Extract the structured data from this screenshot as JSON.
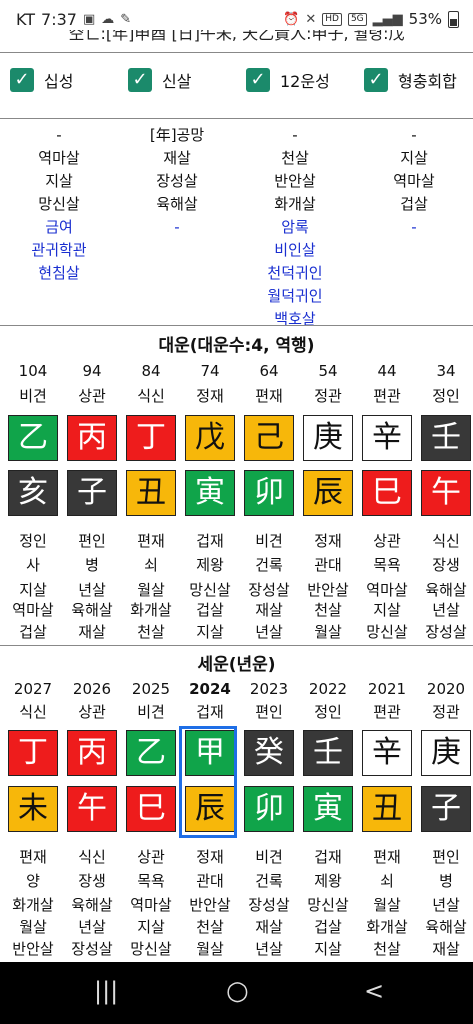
{
  "status": {
    "carrier": "KT",
    "time": "7:37",
    "icons_left": [
      "gallery-icon",
      "cloud-icon",
      "app-icon"
    ],
    "hd_label": "HD",
    "net_label": "5G",
    "battery": "53%"
  },
  "top_partial_text": "空亡:[年]申酉 [日]午未, 天乙貴人:申子, 월령:戊",
  "checkboxes": [
    {
      "label": "십성",
      "checked": true
    },
    {
      "label": "신살",
      "checked": true
    },
    {
      "label": "12운성",
      "checked": true
    },
    {
      "label": "형충회합",
      "checked": true
    }
  ],
  "shinsal": {
    "columns": [
      {
        "head": "-",
        "black": [
          "역마살",
          "지살",
          "망신살"
        ],
        "blue": [
          "금여",
          "관귀학관",
          "현침살"
        ]
      },
      {
        "head": "[年]공망",
        "black": [
          "재살",
          "장성살",
          "육해살"
        ],
        "blue": [
          "-"
        ]
      },
      {
        "head": "-",
        "black": [
          "천살",
          "반안살",
          "화개살"
        ],
        "blue": [
          "암록",
          "비인살",
          "천덕귀인",
          "월덕귀인",
          "백호살"
        ]
      },
      {
        "head": "-",
        "black": [
          "지살",
          "역마살",
          "겁살"
        ],
        "blue": [
          "-"
        ]
      }
    ]
  },
  "daeun": {
    "title": "대운(대운수:4, 역행)",
    "ages": [
      "104",
      "94",
      "84",
      "74",
      "64",
      "54",
      "44",
      "34"
    ],
    "top_ten_gods": [
      "비견",
      "상관",
      "식신",
      "정재",
      "편재",
      "정관",
      "편관",
      "정인"
    ],
    "stems": [
      {
        "char": "乙",
        "color": "green"
      },
      {
        "char": "丙",
        "color": "red"
      },
      {
        "char": "丁",
        "color": "red"
      },
      {
        "char": "戊",
        "color": "yellow"
      },
      {
        "char": "己",
        "color": "yellow"
      },
      {
        "char": "庚",
        "color": "white"
      },
      {
        "char": "辛",
        "color": "white"
      },
      {
        "char": "壬",
        "color": "black"
      }
    ],
    "branches": [
      {
        "char": "亥",
        "color": "black"
      },
      {
        "char": "子",
        "color": "black"
      },
      {
        "char": "丑",
        "color": "yellow"
      },
      {
        "char": "寅",
        "color": "green"
      },
      {
        "char": "卯",
        "color": "green"
      },
      {
        "char": "辰",
        "color": "yellow"
      },
      {
        "char": "巳",
        "color": "red"
      },
      {
        "char": "午",
        "color": "red"
      }
    ],
    "bottom_ten_gods": [
      "정인",
      "편인",
      "편재",
      "겁재",
      "비견",
      "정재",
      "상관",
      "식신"
    ],
    "twelve_states": [
      "사",
      "병",
      "쇠",
      "제왕",
      "건록",
      "관대",
      "목욕",
      "장생"
    ],
    "sal1": [
      "지살",
      "년살",
      "월살",
      "망신살",
      "장성살",
      "반안살",
      "역마살",
      "육해살"
    ],
    "sal2": [
      "역마살",
      "육해살",
      "화개살",
      "겁살",
      "재살",
      "천살",
      "지살",
      "년살"
    ],
    "sal3": [
      "겁살",
      "재살",
      "천살",
      "지살",
      "년살",
      "월살",
      "망신살",
      "장성살"
    ]
  },
  "seun": {
    "title": "세운(년운)",
    "years": [
      "2027",
      "2026",
      "2025",
      "2024",
      "2023",
      "2022",
      "2021",
      "2020"
    ],
    "current_year_index": 3,
    "top_ten_gods": [
      "식신",
      "상관",
      "비견",
      "겁재",
      "편인",
      "정인",
      "편관",
      "정관"
    ],
    "stems": [
      {
        "char": "丁",
        "color": "red"
      },
      {
        "char": "丙",
        "color": "red"
      },
      {
        "char": "乙",
        "color": "green"
      },
      {
        "char": "甲",
        "color": "green"
      },
      {
        "char": "癸",
        "color": "black"
      },
      {
        "char": "壬",
        "color": "black"
      },
      {
        "char": "辛",
        "color": "white"
      },
      {
        "char": "庚",
        "color": "white"
      }
    ],
    "branches": [
      {
        "char": "未",
        "color": "yellow"
      },
      {
        "char": "午",
        "color": "red"
      },
      {
        "char": "巳",
        "color": "red"
      },
      {
        "char": "辰",
        "color": "yellow"
      },
      {
        "char": "卯",
        "color": "green"
      },
      {
        "char": "寅",
        "color": "green"
      },
      {
        "char": "丑",
        "color": "yellow"
      },
      {
        "char": "子",
        "color": "black"
      }
    ],
    "bottom_ten_gods": [
      "편재",
      "식신",
      "상관",
      "정재",
      "비견",
      "겁재",
      "편재",
      "편인"
    ],
    "twelve_states": [
      "양",
      "장생",
      "목욕",
      "관대",
      "건록",
      "제왕",
      "쇠",
      "병"
    ],
    "sal1": [
      "화개살",
      "육해살",
      "역마살",
      "반안살",
      "장성살",
      "망신살",
      "월살",
      "년살"
    ],
    "sal2": [
      "월살",
      "년살",
      "지살",
      "천살",
      "재살",
      "겁살",
      "화개살",
      "육해살"
    ],
    "sal3": [
      "반안살",
      "장성살",
      "망신살",
      "월살",
      "년살",
      "지살",
      "천살",
      "재살"
    ]
  },
  "nav": {
    "recent": "|||",
    "home": "○",
    "back": "<"
  }
}
